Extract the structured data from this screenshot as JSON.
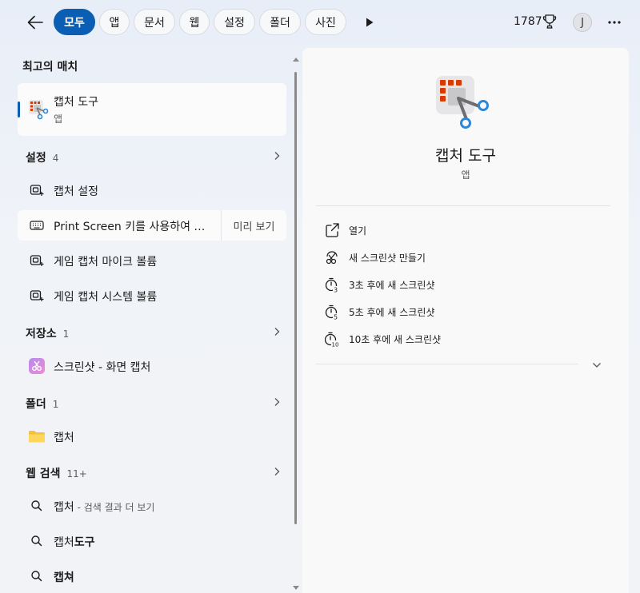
{
  "topbar": {
    "back_icon": "arrow-left-icon",
    "filters": [
      "모두",
      "앱",
      "문서",
      "웹",
      "설정",
      "폴더",
      "사진"
    ],
    "active_filter": "모두",
    "play_icon": "play-icon",
    "points": "1787",
    "trophy_icon": "trophy-icon",
    "avatar_initial": "J",
    "more_label": "···"
  },
  "best_match": {
    "header": "최고의 매치",
    "title": "캡처 도구",
    "subtitle": "앱"
  },
  "settings": {
    "header": "설정",
    "count": "4",
    "items": [
      {
        "label": "캡처 설정",
        "icon": "capture-settings-icon"
      },
      {
        "label": "Print Screen 키를 사용하여 …",
        "icon": "keyboard-icon",
        "preview": "미리 보기"
      },
      {
        "label": "게임 캡처 마이크 볼륨",
        "icon": "capture-settings-icon"
      },
      {
        "label": "게임 캡처 시스템 볼륨",
        "icon": "capture-settings-icon"
      }
    ]
  },
  "store": {
    "header": "저장소",
    "count": "1",
    "items": [
      {
        "label": "스크린샷 - 화면 캡처",
        "icon": "screenshot-app-icon"
      }
    ]
  },
  "folders": {
    "header": "폴더",
    "count": "1",
    "items": [
      {
        "label": "캡처",
        "icon": "folder-icon"
      }
    ]
  },
  "web": {
    "header": "웹 검색",
    "count": "11+",
    "items": [
      {
        "main": "캡처",
        "hint": " - 검색 결과 더 보기"
      },
      {
        "pre": "캡처",
        "bold": "도구"
      },
      {
        "bold": "캡쳐"
      }
    ]
  },
  "details": {
    "title": "캡처 도구",
    "type": "앱",
    "actions": [
      {
        "label": "열기",
        "icon": "open-external-icon"
      },
      {
        "label": "새 스크린샷 만들기",
        "icon": "new-screenshot-icon"
      },
      {
        "label": "3초 후에 새 스크린샷",
        "icon": "timer-3-icon"
      },
      {
        "label": "5초 후에 새 스크린샷",
        "icon": "timer-5-icon"
      },
      {
        "label": "10초 후에 새 스크린샷",
        "icon": "timer-10-icon"
      }
    ]
  },
  "colors": {
    "accent": "#0a5fb4",
    "snip_red": "#d83b01",
    "snip_blue": "#2b88d8"
  }
}
